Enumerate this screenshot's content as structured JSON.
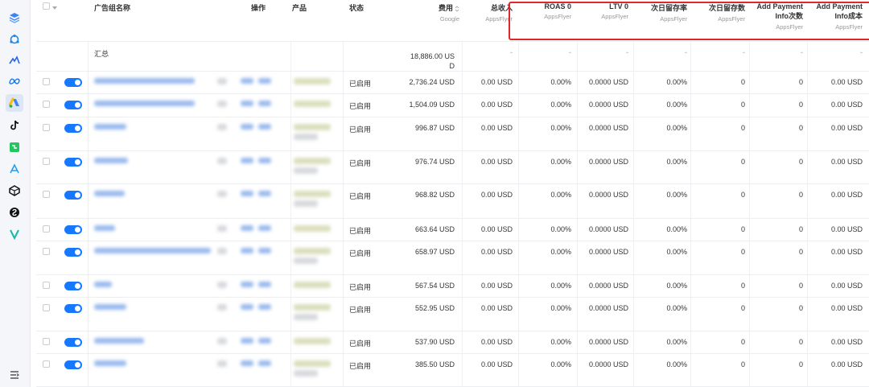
{
  "sidebar": {
    "icons": [
      "layers-icon",
      "network-icon",
      "bird-logo-icon",
      "meta-icon",
      "google-ads-icon",
      "tiktok-icon",
      "grid-logo-icon",
      "apple-search-icon",
      "unity-icon",
      "ironsource-icon",
      "vungle-icon",
      "menu-collapse-icon"
    ]
  },
  "header": {
    "name": "广告组名称",
    "actions": "操作",
    "product": "产品",
    "status": "状态",
    "cost": "费用",
    "cost_sub": "Google",
    "revenue": "总收入",
    "roas": "ROAS 0",
    "ltv": "LTV 0",
    "retention_rate": "次日留存率",
    "retention_count": "次日留存数",
    "add_payment_count_1": "Add Payment",
    "add_payment_count_2": "Info次数",
    "add_payment_cost_1": "Add Payment",
    "add_payment_cost_2": "Info成本",
    "source": "AppsFlyer"
  },
  "summary": {
    "label": "汇总",
    "cost_1": "18,886.00 US",
    "cost_2": "D",
    "dash": "-"
  },
  "rows": [
    {
      "status": "已启用",
      "cost": "2,736.24 USD",
      "revenue": "0.00 USD",
      "roas": "0.00%",
      "ltv": "0.0000 USD",
      "ret_rate": "0.00%",
      "ret_count": "0",
      "ap_count": "0",
      "ap_cost": "0.00 USD"
    },
    {
      "status": "已启用",
      "cost": "1,504.09 USD",
      "revenue": "0.00 USD",
      "roas": "0.00%",
      "ltv": "0.0000 USD",
      "ret_rate": "0.00%",
      "ret_count": "0",
      "ap_count": "0",
      "ap_cost": "0.00 USD"
    },
    {
      "status": "已启用",
      "cost": "996.87 USD",
      "revenue": "0.00 USD",
      "roas": "0.00%",
      "ltv": "0.0000 USD",
      "ret_rate": "0.00%",
      "ret_count": "0",
      "ap_count": "0",
      "ap_cost": "0.00 USD"
    },
    {
      "status": "已启用",
      "cost": "976.74 USD",
      "revenue": "0.00 USD",
      "roas": "0.00%",
      "ltv": "0.0000 USD",
      "ret_rate": "0.00%",
      "ret_count": "0",
      "ap_count": "0",
      "ap_cost": "0.00 USD"
    },
    {
      "status": "已启用",
      "cost": "968.82 USD",
      "revenue": "0.00 USD",
      "roas": "0.00%",
      "ltv": "0.0000 USD",
      "ret_rate": "0.00%",
      "ret_count": "0",
      "ap_count": "0",
      "ap_cost": "0.00 USD"
    },
    {
      "status": "已启用",
      "cost": "663.64 USD",
      "revenue": "0.00 USD",
      "roas": "0.00%",
      "ltv": "0.0000 USD",
      "ret_rate": "0.00%",
      "ret_count": "0",
      "ap_count": "0",
      "ap_cost": "0.00 USD"
    },
    {
      "status": "已启用",
      "cost": "658.97 USD",
      "revenue": "0.00 USD",
      "roas": "0.00%",
      "ltv": "0.0000 USD",
      "ret_rate": "0.00%",
      "ret_count": "0",
      "ap_count": "0",
      "ap_cost": "0.00 USD"
    },
    {
      "status": "已启用",
      "cost": "567.54 USD",
      "revenue": "0.00 USD",
      "roas": "0.00%",
      "ltv": "0.0000 USD",
      "ret_rate": "0.00%",
      "ret_count": "0",
      "ap_count": "0",
      "ap_cost": "0.00 USD"
    },
    {
      "status": "已启用",
      "cost": "552.95 USD",
      "revenue": "0.00 USD",
      "roas": "0.00%",
      "ltv": "0.0000 USD",
      "ret_rate": "0.00%",
      "ret_count": "0",
      "ap_count": "0",
      "ap_cost": "0.00 USD"
    },
    {
      "status": "已启用",
      "cost": "537.90 USD",
      "revenue": "0.00 USD",
      "roas": "0.00%",
      "ltv": "0.0000 USD",
      "ret_rate": "0.00%",
      "ret_count": "0",
      "ap_count": "0",
      "ap_cost": "0.00 USD"
    },
    {
      "status": "已启用",
      "cost": "385.50 USD",
      "revenue": "0.00 USD",
      "roas": "0.00%",
      "ltv": "0.0000 USD",
      "ret_rate": "0.00%",
      "ret_count": "0",
      "ap_count": "0",
      "ap_cost": "0.00 USD"
    }
  ]
}
